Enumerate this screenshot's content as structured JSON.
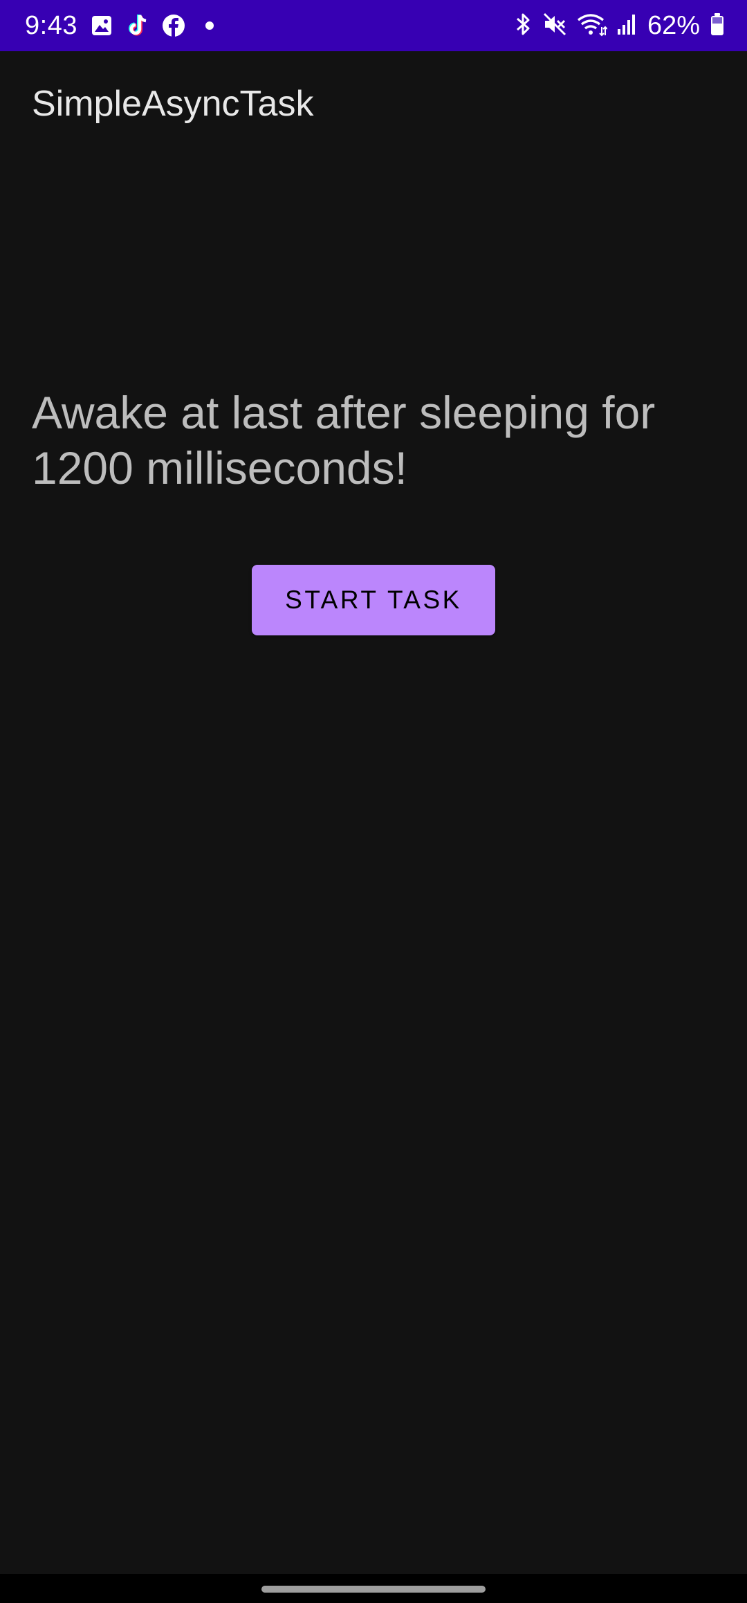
{
  "status_bar": {
    "time": "9:43",
    "notification_icons": [
      "gallery-icon",
      "tiktok-icon",
      "facebook-icon",
      "dot-icon"
    ],
    "system_icons": [
      "bluetooth-icon",
      "mute-icon",
      "wifi-icon",
      "signal-icon",
      "battery-icon"
    ],
    "battery_percent": "62%",
    "background_color": "#3700b3"
  },
  "app": {
    "title": "SimpleAsyncTask"
  },
  "main": {
    "message": "Awake at last after sleeping for 1200 milliseconds!",
    "start_button_label": "START TASK",
    "accent_color": "#bb86fc",
    "background_color": "#121212"
  }
}
